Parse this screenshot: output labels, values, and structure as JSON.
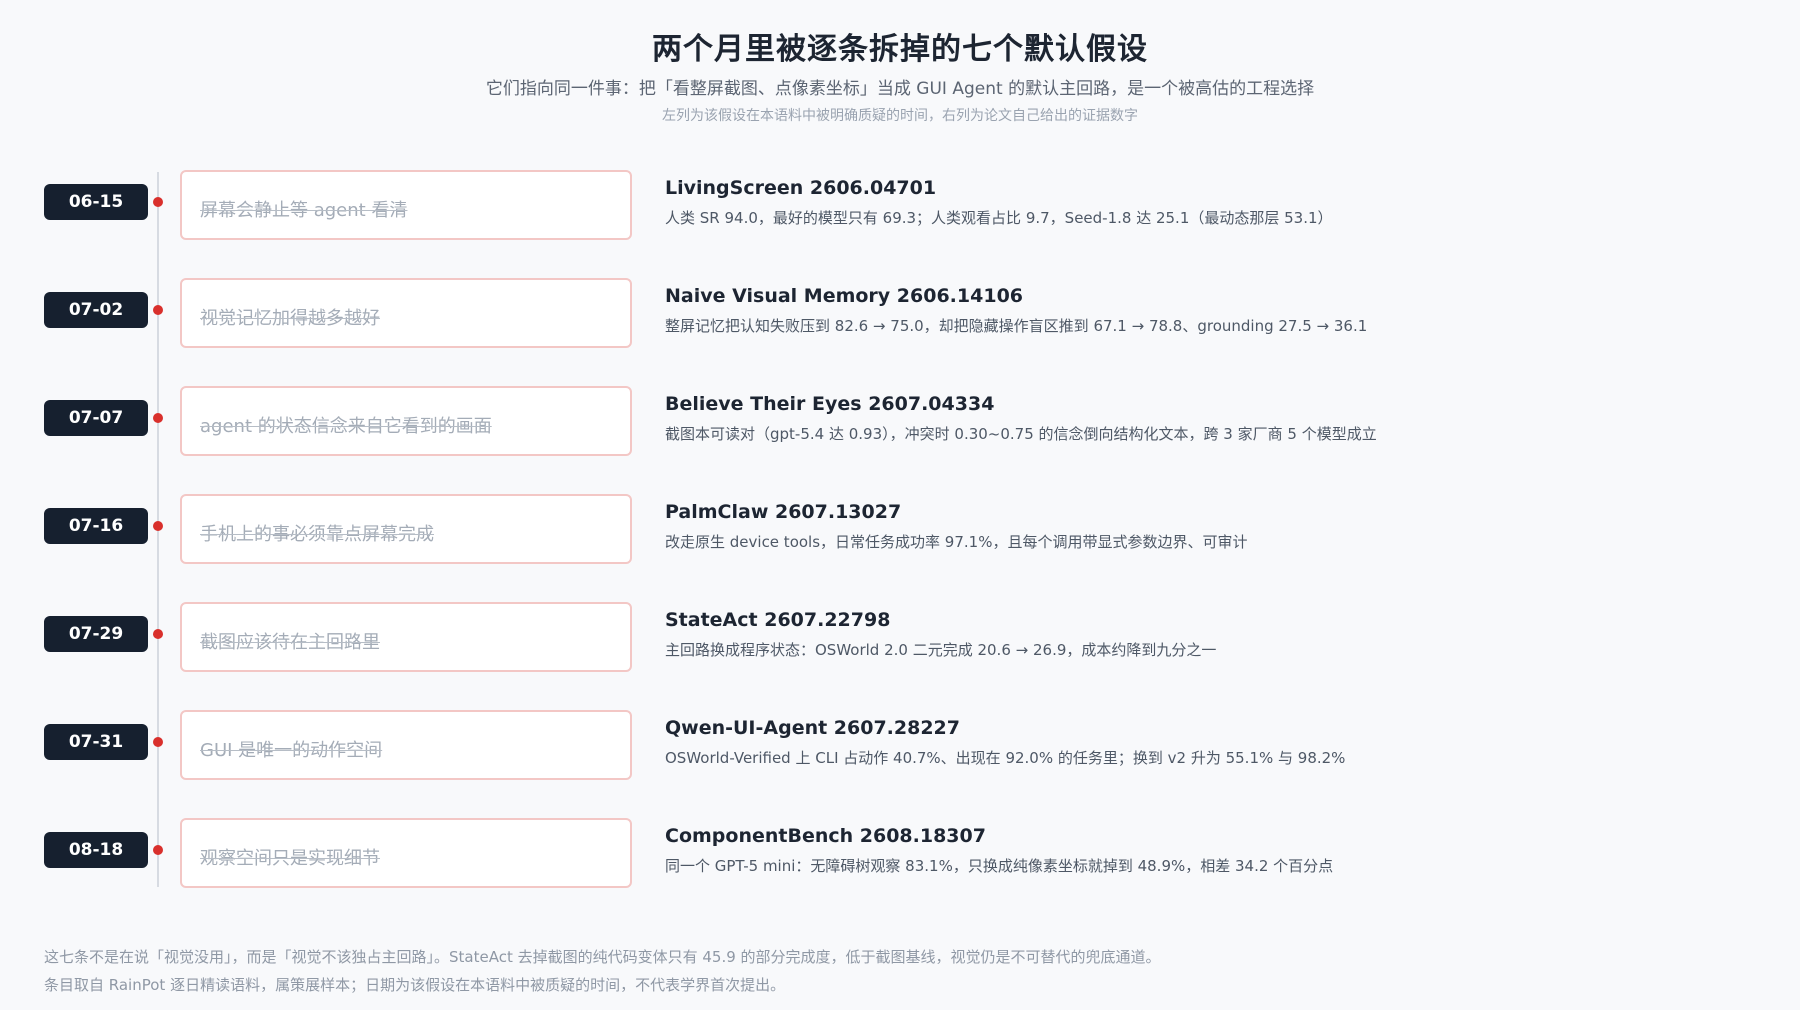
{
  "header": {
    "title": "两个月里被逐条拆掉的七个默认假设",
    "subtitle": "它们指向同一件事：把「看整屏截图、点像素坐标」当成 GUI Agent 的默认主回路，是一个被高估的工程选择",
    "note": "左列为该假设在本语料中被明确质疑的时间，右列为论文自己给出的证据数字"
  },
  "rows": [
    {
      "date": "06-15",
      "assumption": "屏幕会静止等 agent 看清",
      "evidence_title": "LivingScreen 2606.04701",
      "evidence_detail": "人类 SR 94.0，最好的模型只有 69.3；人类观看占比 9.7，Seed-1.8 达 25.1（最动态那层 53.1）"
    },
    {
      "date": "07-02",
      "assumption": "视觉记忆加得越多越好",
      "evidence_title": "Naive Visual Memory 2606.14106",
      "evidence_detail": "整屏记忆把认知失败压到 82.6 → 75.0，却把隐藏操作盲区推到 67.1 → 78.8、grounding 27.5 → 36.1"
    },
    {
      "date": "07-07",
      "assumption": "agent 的状态信念来自它看到的画面",
      "evidence_title": "Believe Their Eyes 2607.04334",
      "evidence_detail": "截图本可读对（gpt-5.4 达 0.93），冲突时 0.30~0.75 的信念倒向结构化文本，跨 3 家厂商 5 个模型成立"
    },
    {
      "date": "07-16",
      "assumption": "手机上的事必须靠点屏幕完成",
      "evidence_title": "PalmClaw 2607.13027",
      "evidence_detail": "改走原生 device tools，日常任务成功率 97.1%，且每个调用带显式参数边界、可审计"
    },
    {
      "date": "07-29",
      "assumption": "截图应该待在主回路里",
      "evidence_title": "StateAct 2607.22798",
      "evidence_detail": "主回路换成程序状态：OSWorld 2.0 二元完成 20.6 → 26.9，成本约降到九分之一"
    },
    {
      "date": "07-31",
      "assumption": "GUI 是唯一的动作空间",
      "evidence_title": "Qwen-UI-Agent 2607.28227",
      "evidence_detail": "OSWorld-Verified 上 CLI 占动作 40.7%、出现在 92.0% 的任务里；换到 v2 升为 55.1% 与 98.2%"
    },
    {
      "date": "08-18",
      "assumption": "观察空间只是实现细节",
      "evidence_title": "ComponentBench 2608.18307",
      "evidence_detail": "同一个 GPT-5 mini：无障碍树观察 83.1%，只换成纯像素坐标就掉到 48.9%，相差 34.2 个百分点"
    }
  ],
  "footer": {
    "line1": "这七条不是在说「视觉没用」，而是「视觉不该独占主回路」。StateAct 去掉截图的纯代码变体只有 45.9 的部分完成度，低于截图基线，视觉仍是不可替代的兜底通道。",
    "line2": "条目取自 RainPot 逐日精读语料，属策展样本；日期为该假设在本语料中被质疑的时间，不代表学界首次提出。"
  },
  "colors": {
    "badge": "#16202f",
    "dot": "#d9302c",
    "assumption_border": "#f3c7c5"
  }
}
